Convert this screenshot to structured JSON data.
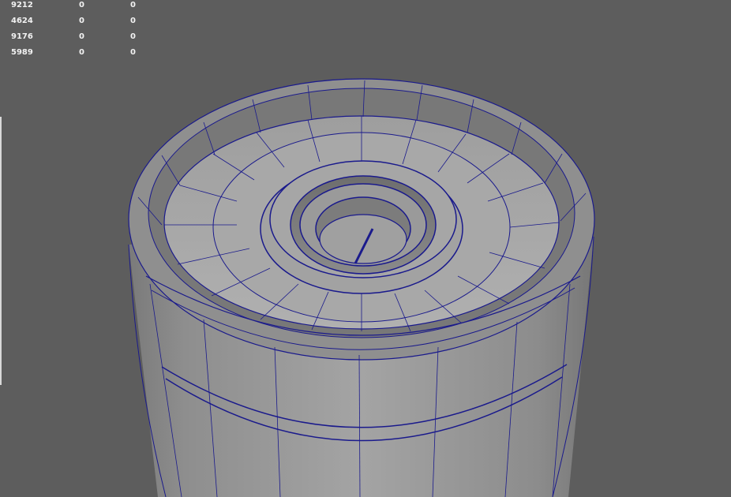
{
  "hud": {
    "rows": [
      {
        "label": "9212",
        "v1": "0",
        "v2": "0"
      },
      {
        "label": "4624",
        "v1": "0",
        "v2": "0"
      },
      {
        "label": "9176",
        "v1": "0",
        "v2": "0"
      },
      {
        "label": "5989",
        "v1": "0",
        "v2": "0"
      }
    ]
  },
  "colors": {
    "viewport_bg": "#5d5d5d",
    "mesh_face": "#9a9a9a",
    "wireframe": "#1a1a8c"
  }
}
